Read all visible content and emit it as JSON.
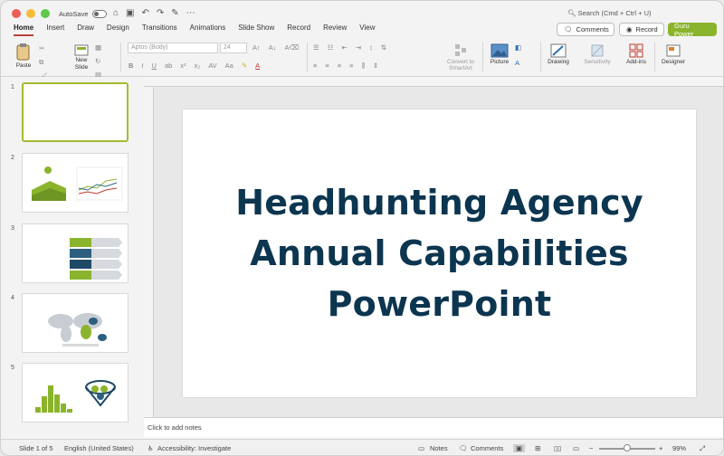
{
  "titlebar": {
    "autosave_label": "AutoSave",
    "search_placeholder": "Search (Cmd + Ctrl + U)"
  },
  "tabs": [
    "Home",
    "Insert",
    "Draw",
    "Design",
    "Transitions",
    "Animations",
    "Slide Show",
    "Record",
    "Review",
    "View"
  ],
  "actions": {
    "comments": "Comments",
    "record": "Record",
    "guru": "Guru Power"
  },
  "ribbon": {
    "paste": "Paste",
    "new_slide": "New\nSlide",
    "font_name": "Aptos (Body)",
    "font_size": "24",
    "convert": "Convert to\nSmartArt",
    "picture": "Picture",
    "drawing": "Drawing",
    "sensitivity": "Sensitivity",
    "addins": "Add-ins",
    "designer": "Designer"
  },
  "slides": [
    {
      "num": "1"
    },
    {
      "num": "2"
    },
    {
      "num": "3"
    },
    {
      "num": "4"
    },
    {
      "num": "5"
    }
  ],
  "slide_title": "Headhunting Agency Annual Capabilities PowerPoint",
  "slide_title_lines": [
    "Headhunting Agency",
    "Annual Capabilities",
    "PowerPoint"
  ],
  "notes_placeholder": "Click to add notes",
  "status": {
    "slide_of": "Slide 1 of 5",
    "language": "English (United States)",
    "accessibility": "Accessibility: Investigate",
    "notes": "Notes",
    "comments": "Comments",
    "zoom": "99%"
  },
  "colors": {
    "accent": "#8bb42d",
    "title": "#0c3550",
    "tab_underline": "#b8433a"
  }
}
